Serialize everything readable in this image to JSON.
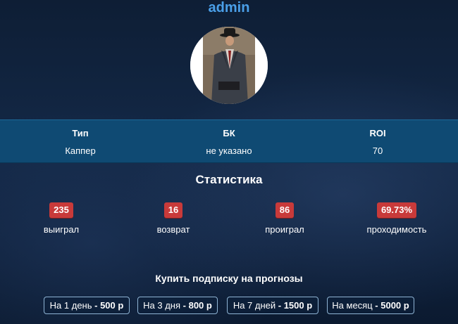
{
  "profile": {
    "username": "admin"
  },
  "info": {
    "type_label": "Тип",
    "type_value": "Каппер",
    "bk_label": "БК",
    "bk_value": "не указано",
    "roi_label": "ROI",
    "roi_value": "70"
  },
  "stats": {
    "title": "Статистика",
    "won": {
      "value": "235",
      "label": "выиграл"
    },
    "refund": {
      "value": "16",
      "label": "возврат"
    },
    "lost": {
      "value": "86",
      "label": "проиграл"
    },
    "passability": {
      "value": "69.73%",
      "label": "проходимость"
    }
  },
  "subscription": {
    "title": "Купить подписку на прогнозы",
    "options": [
      {
        "period": "На 1 день",
        "price": "500 р"
      },
      {
        "period": "На 3 дня",
        "price": "800 р"
      },
      {
        "period": "На 7 дней",
        "price": "1500 р"
      },
      {
        "period": "На месяц",
        "price": "5000 р"
      }
    ],
    "separator": " - "
  },
  "colors": {
    "accent": "#4a9fe8",
    "info_bar": "#0f4a73",
    "badge": "#c83a3a"
  }
}
